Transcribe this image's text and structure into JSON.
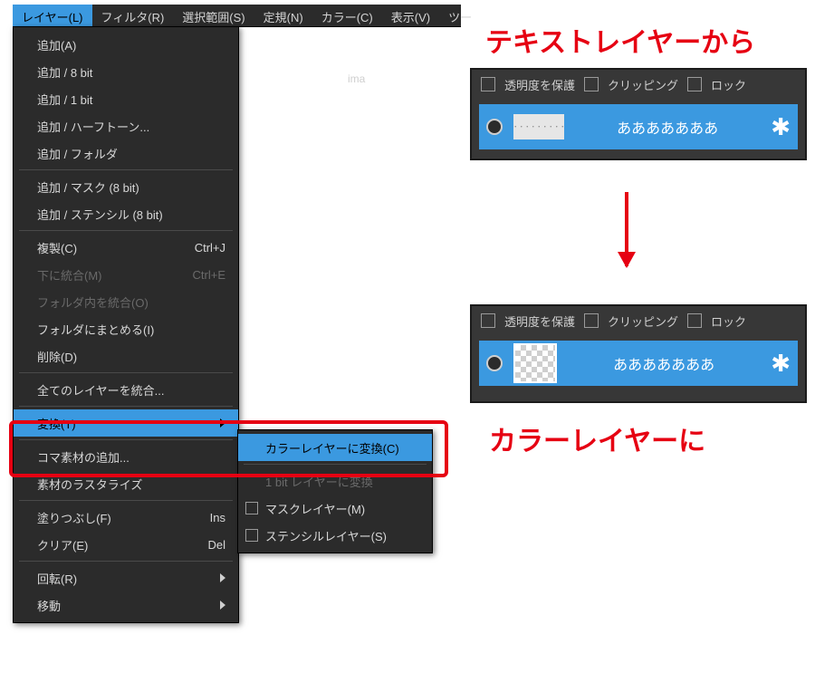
{
  "menubar": {
    "items": [
      {
        "label": "レイヤー(L)",
        "active": true
      },
      {
        "label": "フィルタ(R)"
      },
      {
        "label": "選択範囲(S)"
      },
      {
        "label": "定規(N)"
      },
      {
        "label": "カラー(C)"
      },
      {
        "label": "表示(V)"
      },
      {
        "label": "ツー"
      }
    ]
  },
  "tab_label": "ima",
  "dropdown": [
    {
      "label": "追加(A)"
    },
    {
      "label": "追加 / 8 bit"
    },
    {
      "label": "追加 / 1 bit"
    },
    {
      "label": "追加 / ハーフトーン..."
    },
    {
      "label": "追加 / フォルダ"
    },
    {
      "sep": true
    },
    {
      "label": "追加 / マスク (8 bit)"
    },
    {
      "label": "追加 / ステンシル (8 bit)"
    },
    {
      "sep": true
    },
    {
      "label": "複製(C)",
      "shortcut": "Ctrl+J"
    },
    {
      "label": "下に統合(M)",
      "shortcut": "Ctrl+E",
      "disabled": true
    },
    {
      "label": "フォルダ内を統合(O)",
      "disabled": true
    },
    {
      "label": "フォルダにまとめる(I)"
    },
    {
      "label": "削除(D)"
    },
    {
      "sep": true
    },
    {
      "label": "全てのレイヤーを統合..."
    },
    {
      "sep": true
    },
    {
      "label": "変換(T)",
      "submenu": true,
      "highlight": true
    },
    {
      "sep": true
    },
    {
      "label": "コマ素材の追加..."
    },
    {
      "label": "素材のラスタライズ"
    },
    {
      "sep": true
    },
    {
      "label": "塗りつぶし(F)",
      "shortcut": "Ins"
    },
    {
      "label": "クリア(E)",
      "shortcut": "Del"
    },
    {
      "sep": true
    },
    {
      "label": "回転(R)",
      "submenu": true
    },
    {
      "label": "移動",
      "submenu": true
    }
  ],
  "submenu": [
    {
      "label": "カラーレイヤーに変換(C)",
      "highlight": true
    },
    {
      "sep": true
    },
    {
      "label": "1 bit レイヤーに変換",
      "disabled": true
    },
    {
      "label": "マスクレイヤー(M)",
      "checkbox": true
    },
    {
      "label": "ステンシルレイヤー(S)",
      "checkbox": true
    }
  ],
  "panel": {
    "opt_transparent": "透明度を保護",
    "opt_clipping": "クリッピング",
    "opt_lock": "ロック",
    "layer_name": "あああああああ",
    "thumb_text": "・・・・・・・・・"
  },
  "annotations": {
    "top": "テキストレイヤーから",
    "bottom": "カラーレイヤーに"
  }
}
